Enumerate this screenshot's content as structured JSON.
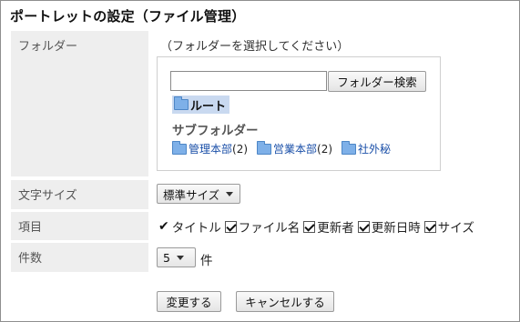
{
  "title": "ポートレットの設定（ファイル管理）",
  "labels": {
    "folder": "フォルダー",
    "font_size": "文字サイズ",
    "items": "項目",
    "count": "件数"
  },
  "folder": {
    "hint": "（フォルダーを選択してください）",
    "search_value": "",
    "search_button": "フォルダー検索",
    "root": "ルート",
    "subfolder_heading": "サブフォルダー",
    "subfolders": [
      {
        "name": "管理本部",
        "count": "(2)"
      },
      {
        "name": "営業本部",
        "count": "(2)"
      },
      {
        "name": "社外秘",
        "count": ""
      }
    ]
  },
  "font_size": {
    "selected": "標準サイズ"
  },
  "items": {
    "fixed": "タイトル",
    "checkboxes": [
      "ファイル名",
      "更新者",
      "更新日時",
      "サイズ"
    ]
  },
  "count": {
    "selected": "5",
    "unit": "件"
  },
  "buttons": {
    "change": "変更する",
    "cancel": "キャンセルする"
  },
  "icons": {
    "folder": "folder-icon",
    "check": "checkmark-icon",
    "dropdown": "chevron-down-icon"
  }
}
